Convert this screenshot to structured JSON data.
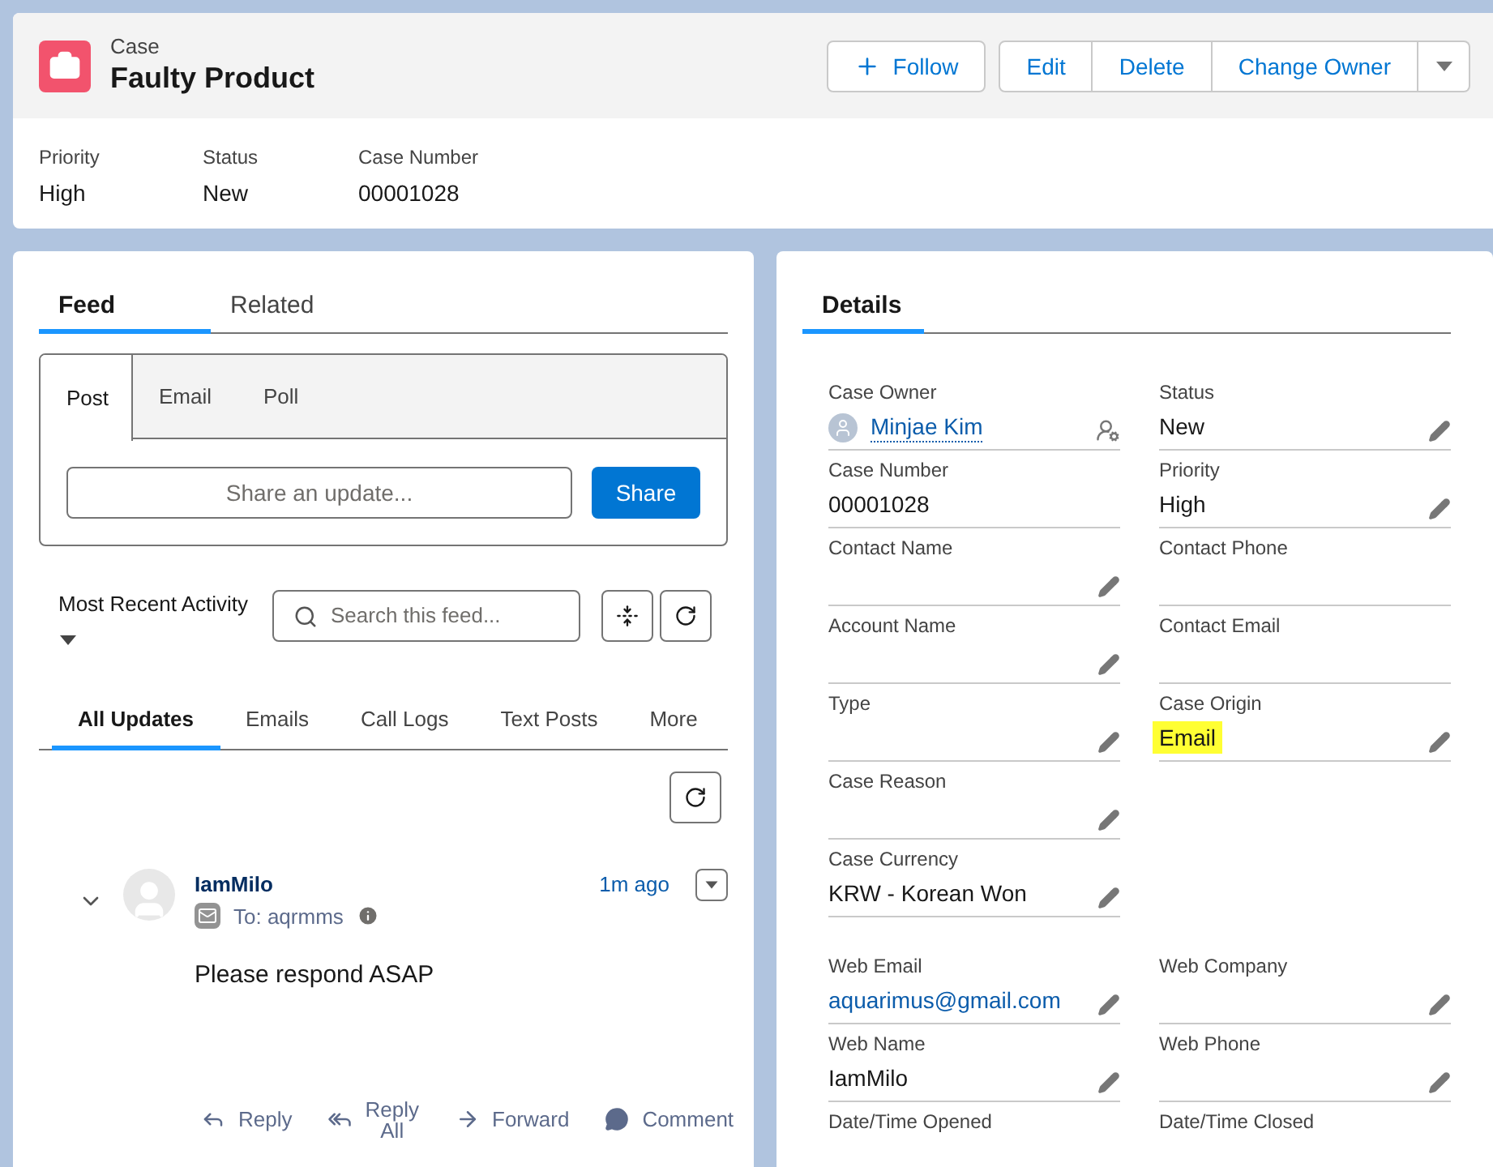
{
  "header": {
    "object_type": "Case",
    "title": "Faulty Product",
    "actions": [
      {
        "label": "Follow",
        "kind": "follow"
      },
      {
        "label": "Edit",
        "kind": "plain"
      },
      {
        "label": "Delete",
        "kind": "plain"
      },
      {
        "label": "Change Owner",
        "kind": "plain"
      },
      {
        "kind": "menu"
      }
    ],
    "highlights": [
      {
        "label": "Priority",
        "value": "High"
      },
      {
        "label": "Status",
        "value": "New"
      },
      {
        "label": "Case Number",
        "value": "00001028"
      }
    ]
  },
  "feed_panel": {
    "tabs": [
      {
        "label": "Feed",
        "selected": true
      },
      {
        "label": "Related",
        "selected": false
      }
    ],
    "publisher": {
      "tabs": [
        {
          "label": "Post",
          "selected": true
        },
        {
          "label": "Email",
          "selected": false
        },
        {
          "label": "Poll",
          "selected": false
        }
      ],
      "placeholder": "Share an update...",
      "button": "Share"
    },
    "sort": "Most Recent Activity",
    "search": {
      "placeholder": "Search this feed..."
    },
    "filters": [
      {
        "label": "All Updates",
        "selected": true
      },
      {
        "label": "Emails",
        "selected": false
      },
      {
        "label": "Call Logs",
        "selected": false
      },
      {
        "label": "Text Posts",
        "selected": false
      },
      {
        "label": "More",
        "selected": false
      }
    ],
    "items": [
      {
        "author": "IamMilo",
        "time": "1m ago",
        "to": "To: aqrmms",
        "body": "Please respond ASAP",
        "actions": [
          {
            "label": "Reply",
            "kind": "reply"
          },
          {
            "label": "Reply All",
            "kind": "reply-all"
          },
          {
            "label": "Forward",
            "kind": "forward"
          },
          {
            "label": "Comment",
            "kind": "comment"
          }
        ]
      }
    ]
  },
  "details_panel": {
    "tabs": [
      {
        "label": "Details",
        "selected": true
      }
    ],
    "sections": [
      [
        {
          "left": {
            "label": "Case Owner",
            "value": "Minjae Kim",
            "kind": "owner",
            "editable": true
          },
          "right": {
            "label": "Status",
            "value": "New",
            "kind": "text",
            "editable": true
          }
        },
        {
          "left": {
            "label": "Case Number",
            "value": "00001028",
            "kind": "text",
            "editable": false
          },
          "right": {
            "label": "Priority",
            "value": "High",
            "kind": "text",
            "editable": true
          }
        },
        {
          "left": {
            "label": "Contact Name",
            "editable": true
          },
          "right": {
            "label": "Contact Phone",
            "editable": false
          }
        },
        {
          "left": {
            "label": "Account Name",
            "editable": true
          },
          "right": {
            "label": "Contact Email",
            "editable": false
          }
        },
        {
          "left": {
            "label": "Type",
            "editable": true
          },
          "right": {
            "label": "Case Origin",
            "value": "Email",
            "kind": "highlighted",
            "editable": true
          }
        },
        {
          "left": {
            "label": "Case Reason",
            "editable": true
          }
        },
        {
          "left": {
            "label": "Case Currency",
            "value": "KRW - Korean Won",
            "kind": "text",
            "editable": true
          }
        }
      ],
      [
        {
          "left": {
            "label": "Web Email",
            "value": "aquarimus@gmail.com",
            "kind": "link",
            "editable": true
          },
          "right": {
            "label": "Web Company",
            "editable": true
          }
        },
        {
          "left": {
            "label": "Web Name",
            "value": "IamMilo",
            "kind": "text",
            "editable": true
          },
          "right": {
            "label": "Web Phone",
            "editable": true
          }
        },
        {
          "left": {
            "label": "Date/Time Opened",
            "editable": false
          },
          "right": {
            "label": "Date/Time Closed",
            "editable": false
          }
        }
      ]
    ]
  }
}
